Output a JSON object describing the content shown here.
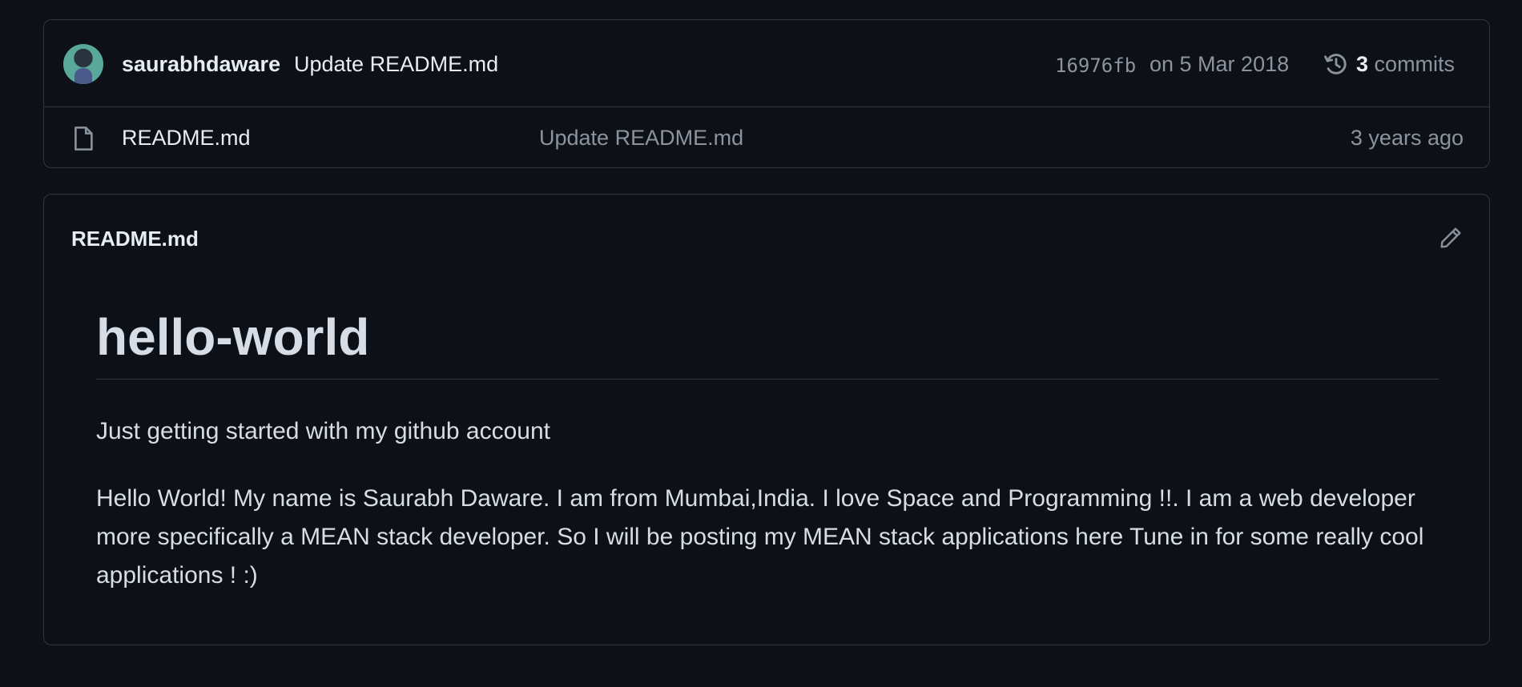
{
  "latest_commit": {
    "author": "saurabhdaware",
    "message": "Update README.md",
    "sha": "16976fb",
    "date": "on 5 Mar 2018",
    "commits_count": "3",
    "commits_label": "commits"
  },
  "files": [
    {
      "name": "README.md",
      "commit_message": "Update README.md",
      "age": "3 years ago",
      "icon": "file-icon"
    }
  ],
  "readme": {
    "header": "README.md",
    "heading": "hello-world",
    "paragraph1": "Just getting started with my github account",
    "paragraph2": "Hello World! My name is Saurabh Daware. I am from Mumbai,India. I love Space and Programming !!. I am a web developer more specifically a MEAN stack developer. So I will be posting my MEAN stack applications here Tune in for some really cool applications ! :)"
  },
  "icons": {
    "history": "history-icon",
    "edit": "pencil-icon"
  }
}
